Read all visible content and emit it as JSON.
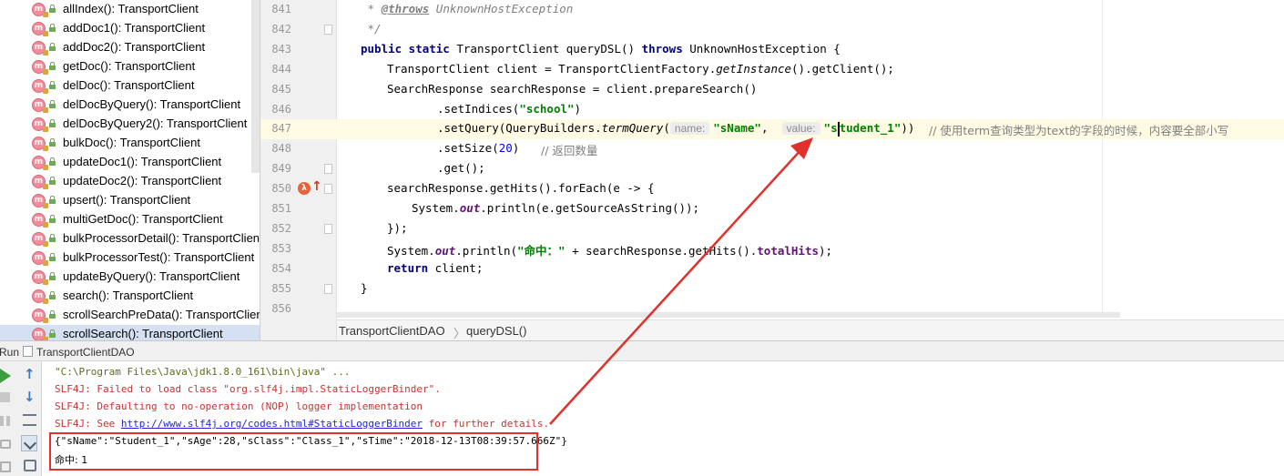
{
  "structure": {
    "icon_letter": "m",
    "items": [
      {
        "label": "allIndex(): TransportClient"
      },
      {
        "label": "addDoc1(): TransportClient"
      },
      {
        "label": "addDoc2(): TransportClient"
      },
      {
        "label": "getDoc(): TransportClient"
      },
      {
        "label": "delDoc(): TransportClient"
      },
      {
        "label": "delDocByQuery(): TransportClient"
      },
      {
        "label": "delDocByQuery2(): TransportClient"
      },
      {
        "label": "bulkDoc(): TransportClient"
      },
      {
        "label": "updateDoc1(): TransportClient"
      },
      {
        "label": "updateDoc2(): TransportClient"
      },
      {
        "label": "upsert(): TransportClient"
      },
      {
        "label": "multiGetDoc(): TransportClient"
      },
      {
        "label": "bulkProcessorDetail(): TransportClient"
      },
      {
        "label": "bulkProcessorTest(): TransportClient"
      },
      {
        "label": "updateByQuery(): TransportClient"
      },
      {
        "label": "search(): TransportClient"
      },
      {
        "label": "scrollSearchPreData(): TransportClient"
      },
      {
        "label": "scrollSearch(): TransportClient"
      }
    ]
  },
  "editor": {
    "line_numbers": [
      "841",
      "842",
      "843",
      "844",
      "845",
      "846",
      "847",
      "848",
      "849",
      "850",
      "851",
      "852",
      "853",
      "854",
      "855",
      "856"
    ],
    "gutter_lambda": "λ",
    "gutter_arrow": "↑",
    "l841": {
      "star": " * ",
      "tag": "@throws",
      "rest": " UnknownHostException"
    },
    "l842": {
      "text": " */"
    },
    "l843": {
      "kw1": "public static",
      "mid": " TransportClient queryDSL() ",
      "kw2": "throws",
      "rest": " UnknownHostException {"
    },
    "l844": {
      "a": "TransportClient client = TransportClientFactory.",
      "b": "getInstance",
      "c": "().getClient();"
    },
    "l845": {
      "text": "SearchResponse searchResponse = client.prepareSearch()"
    },
    "l846": {
      "a": ".setIndices(",
      "str": "\"school\"",
      "c": ")"
    },
    "l847": {
      "a": ".setQuery(QueryBuilders.",
      "b": "termQuery",
      "c": "(",
      "hint1": "name:",
      "str1": "\"sName\"",
      "comma": ",  ",
      "hint2": "value:",
      "str2_a": "\"s",
      "str2_b": "tudent_1\"",
      "d": "))",
      "comment": "// 使用term查询类型为text的字段的时候，内容要全部小写"
    },
    "l848": {
      "a": ".setSize(",
      "num": "20",
      "b": ")",
      "comment": "// 返回数量"
    },
    "l849": {
      "text": ".get();"
    },
    "l850": {
      "text": "searchResponse.getHits().forEach(e -> {"
    },
    "l851": {
      "a": "System.",
      "fld": "out",
      "b": ".println(e.getSourceAsString());"
    },
    "l852": {
      "text": "});"
    },
    "l853": {
      "a": "System.",
      "fld": "out",
      "b": ".println(",
      "str": "\"命中：\"",
      "c": " + searchResponse.getHits().",
      "fld2": "totalHits",
      "d": ");"
    },
    "l854": {
      "kw": "return",
      "rest": " client;"
    },
    "l855": {
      "text": "}"
    },
    "breadcrumb": {
      "class_name": "TransportClientDAO",
      "separator": "〉",
      "method": "queryDSL()"
    }
  },
  "run": {
    "tab_label": "Run",
    "config_name": "TransportClientDAO",
    "lines": {
      "java": "\"C:\\Program Files\\Java\\jdk1.8.0_161\\bin\\java\" ...",
      "slf1": "SLF4J: Failed to load class \"org.slf4j.impl.StaticLoggerBinder\".",
      "slf2": "SLF4J: Defaulting to no-operation (NOP) logger implementation",
      "slf3_pre": "SLF4J: See ",
      "slf3_link": "http://www.slf4j.org/codes.html#StaticLoggerBinder",
      "slf3_post": " for further details.",
      "json": "{\"sName\":\"Student_1\",\"sAge\":28,\"sClass\":\"Class_1\",\"sTime\":\"2018-12-13T08:39:57.666Z\"}",
      "hits": "命中: 1"
    }
  },
  "colors": {
    "annotation_red": "#e0312c",
    "current_line": "#fffae3",
    "keyword": "#000080",
    "string": "#008000"
  }
}
